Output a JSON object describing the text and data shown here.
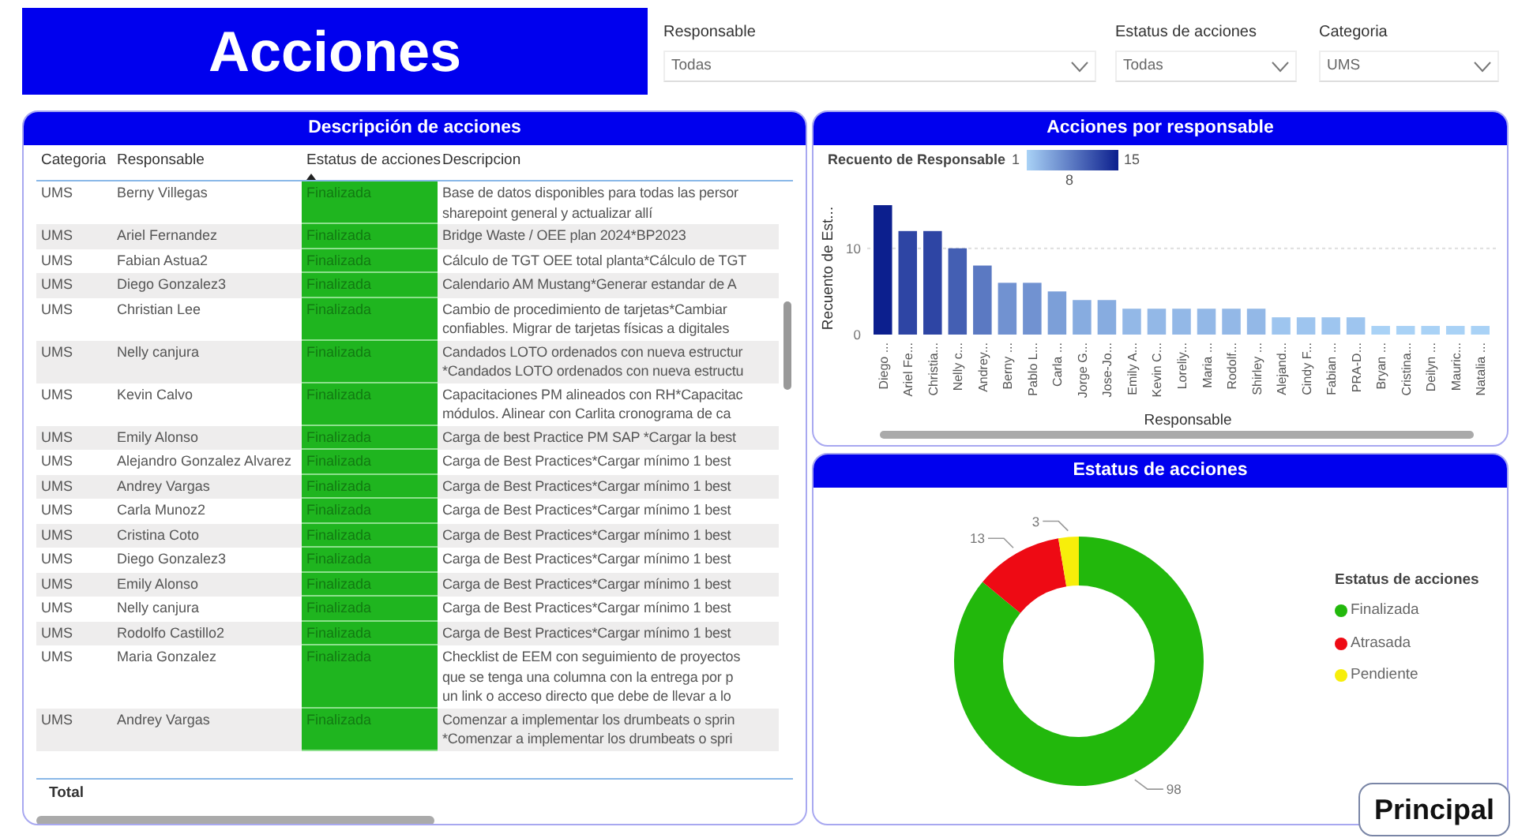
{
  "header": {
    "title": "Acciones"
  },
  "filters": [
    {
      "label": "Responsable",
      "value": "Todas"
    },
    {
      "label": "Estatus de acciones",
      "value": "Todas"
    },
    {
      "label": "Categoria",
      "value": "UMS"
    }
  ],
  "table": {
    "title": "Descripción de acciones",
    "columns": [
      {
        "label": "Categoria",
        "sorted": false
      },
      {
        "label": "Responsable",
        "sorted": false
      },
      {
        "label": "Estatus de acciones",
        "sorted": true
      },
      {
        "label": "Descripcion",
        "sorted": false
      }
    ],
    "rows": [
      {
        "categoria": "UMS",
        "responsable": "Berny Villegas",
        "status": "Finalizada",
        "color": "#1fb51f",
        "description": [
          "Base de datos disponibles para todas las persor",
          "sharepoint general y actualizar allí"
        ]
      },
      {
        "categoria": "UMS",
        "responsable": "Ariel Fernandez",
        "status": "Finalizada",
        "color": "#1fb51f",
        "description": [
          "Bridge Waste / OEE plan 2024*BP2023"
        ]
      },
      {
        "categoria": "UMS",
        "responsable": "Fabian Astua2",
        "status": "Finalizada",
        "color": "#1fb51f",
        "description": [
          "Cálculo de TGT OEE total planta*Cálculo de TGT"
        ]
      },
      {
        "categoria": "UMS",
        "responsable": "Diego Gonzalez3",
        "status": "Finalizada",
        "color": "#1fb51f",
        "description": [
          "Calendario AM Mustang*Generar estandar de A"
        ]
      },
      {
        "categoria": "UMS",
        "responsable": "Christian Lee",
        "status": "Finalizada",
        "color": "#1fb51f",
        "description": [
          "Cambio de procedimiento de tarjetas*Cambiar",
          "confiables. Migrar de tarjetas físicas a digitales"
        ]
      },
      {
        "categoria": "UMS",
        "responsable": "Nelly canjura",
        "status": "Finalizada",
        "color": "#1fb51f",
        "description": [
          "Candados LOTO ordenados con nueva estructur",
          "*Candados LOTO ordenados con nueva estructu"
        ]
      },
      {
        "categoria": "UMS",
        "responsable": "Kevin Calvo",
        "status": "Finalizada",
        "color": "#1fb51f",
        "description": [
          "Capacitaciones PM alineados con RH*Capacitac",
          "módulos. Alinear con Carlita cronograma de ca"
        ]
      },
      {
        "categoria": "UMS",
        "responsable": "Emily Alonso",
        "status": "Finalizada",
        "color": "#1fb51f",
        "description": [
          "Carga de best Practice PM SAP *Cargar la best"
        ]
      },
      {
        "categoria": "UMS",
        "responsable": "Alejandro Gonzalez Alvarez",
        "status": "Finalizada",
        "color": "#1fb51f",
        "description": [
          "Carga de Best Practices*Cargar mínimo 1 best"
        ]
      },
      {
        "categoria": "UMS",
        "responsable": "Andrey Vargas",
        "status": "Finalizada",
        "color": "#1fb51f",
        "description": [
          "Carga de Best Practices*Cargar mínimo 1 best"
        ]
      },
      {
        "categoria": "UMS",
        "responsable": "Carla Munoz2",
        "status": "Finalizada",
        "color": "#1fb51f",
        "description": [
          "Carga de Best Practices*Cargar mínimo 1 best"
        ]
      },
      {
        "categoria": "UMS",
        "responsable": "Cristina Coto",
        "status": "Finalizada",
        "color": "#1fb51f",
        "description": [
          "Carga de Best Practices*Cargar mínimo 1 best"
        ]
      },
      {
        "categoria": "UMS",
        "responsable": "Diego Gonzalez3",
        "status": "Finalizada",
        "color": "#1fb51f",
        "description": [
          "Carga de Best Practices*Cargar mínimo 1 best"
        ]
      },
      {
        "categoria": "UMS",
        "responsable": "Emily Alonso",
        "status": "Finalizada",
        "color": "#1fb51f",
        "description": [
          "Carga de Best Practices*Cargar mínimo 1 best"
        ]
      },
      {
        "categoria": "UMS",
        "responsable": "Nelly canjura",
        "status": "Finalizada",
        "color": "#1fb51f",
        "description": [
          "Carga de Best Practices*Cargar mínimo 1 best"
        ]
      },
      {
        "categoria": "UMS",
        "responsable": "Rodolfo Castillo2",
        "status": "Finalizada",
        "color": "#1fb51f",
        "description": [
          "Carga de Best Practices*Cargar mínimo 1 best"
        ]
      },
      {
        "categoria": "UMS",
        "responsable": "Maria Gonzalez",
        "status": "Finalizada",
        "color": "#1fb51f",
        "description": [
          "Checklist de EEM con seguimiento de proyectos",
          "que se tenga una columna con la entrega por p",
          "un link o acceso directo que debe de llevar a lo"
        ]
      },
      {
        "categoria": "UMS",
        "responsable": "Andrey Vargas",
        "status": "Finalizada",
        "color": "#1fb51f",
        "description": [
          "Comenzar a implementar los drumbeats o sprin",
          "*Comenzar a implementar los drumbeats o spri"
        ]
      }
    ],
    "total_label": "Total"
  },
  "bar_panel": {
    "title": "Acciones por responsable",
    "color_legend": {
      "title": "Recuento de Responsable",
      "min": "1",
      "max": "15",
      "mid": "8"
    },
    "chart_data": {
      "type": "bar",
      "xlabel": "Responsable",
      "ylabel": "Recuento de Est...",
      "categories": [
        "Diego ...",
        "Ariel Fe...",
        "Christia...",
        "Nelly c...",
        "Andrey...",
        "Berny ...",
        "Pablo L...",
        "Carla ...",
        "Jorge G...",
        "Jose-Jo...",
        "Emily A...",
        "Kevin C...",
        "Loreliy...",
        "Maria ...",
        "Rodolf...",
        "Shirley ...",
        "Alejand...",
        "Cindy F...",
        "Fabian ...",
        "PRA-D...",
        "Bryan ...",
        "Cristina...",
        "Deilyn ...",
        "Mauric...",
        "Natalia ..."
      ],
      "values": [
        15,
        12,
        12,
        10,
        8,
        6,
        6,
        5,
        4,
        4,
        3,
        3,
        3,
        3,
        3,
        3,
        2,
        2,
        2,
        2,
        1,
        1,
        1,
        1,
        1
      ],
      "ylim": [
        0,
        15
      ],
      "yticks": [
        0,
        10
      ]
    }
  },
  "status_panel": {
    "title": "Estatus de acciones",
    "legend": {
      "title": "Estatus de acciones",
      "items": [
        {
          "label": "Finalizada",
          "color": "#22b80c"
        },
        {
          "label": "Atrasada",
          "color": "#ee0a14"
        },
        {
          "label": "Pendiente",
          "color": "#f7ee0a"
        }
      ]
    },
    "chart_data": {
      "type": "donut",
      "values": [
        98,
        13,
        3
      ],
      "value_labels": [
        "98",
        "13",
        "3"
      ]
    }
  },
  "principal_button": "Principal"
}
